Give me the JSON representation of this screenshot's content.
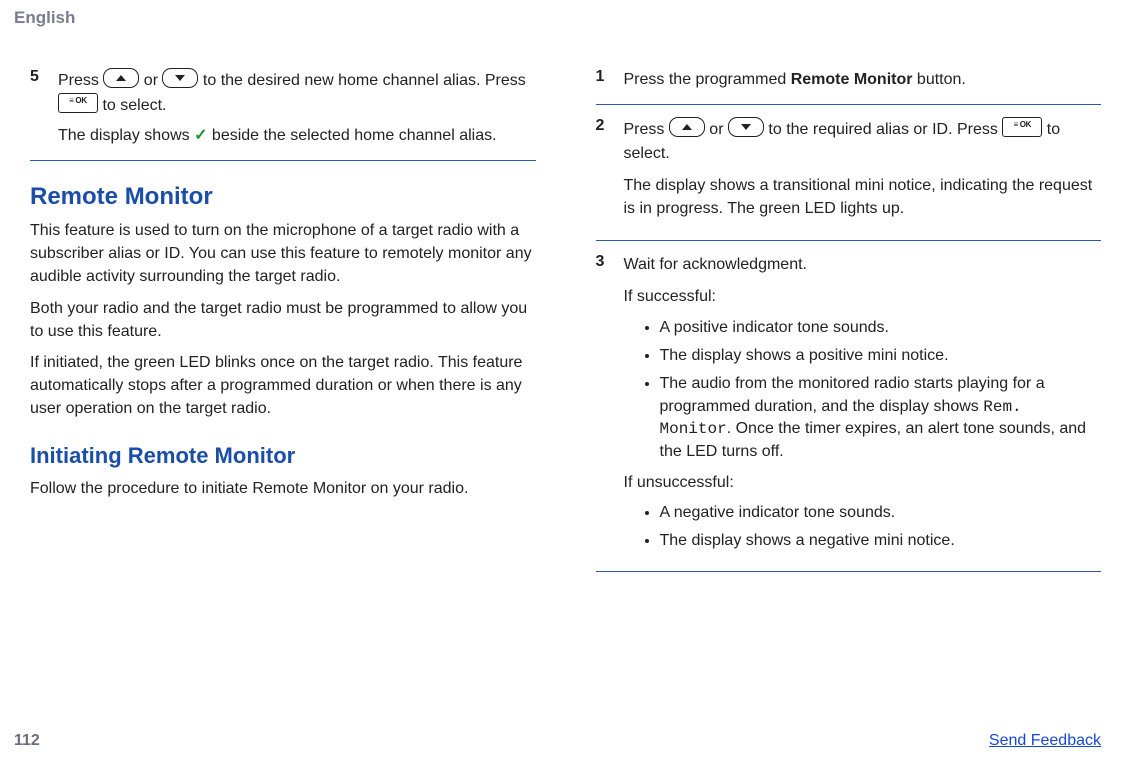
{
  "header": {
    "language": "English"
  },
  "left": {
    "step5": {
      "num": "5",
      "line1a": "Press ",
      "line1b": " or ",
      "line1c": " to the desired new home channel alias. Press ",
      "line1d": " to select.",
      "line2a": "The display shows ",
      "check": "✓",
      "line2b": " beside the selected home channel alias."
    },
    "remote_monitor": {
      "title": "Remote Monitor",
      "p1": "This feature is used to turn on the microphone of a target radio with a subscriber alias or ID. You can use this feature to remotely monitor any audible activity surrounding the target radio.",
      "p2": "Both your radio and the target radio must be programmed to allow you to use this feature.",
      "p3": "If initiated, the green LED blinks once on the target radio. This feature automatically stops after a programmed duration or when there is any user operation on the target radio."
    },
    "initiating": {
      "title": "Initiating Remote Monitor",
      "p1": "Follow the procedure to initiate Remote Monitor on your radio."
    }
  },
  "right": {
    "step1": {
      "num": "1",
      "a": "Press the programmed ",
      "bold": "Remote Monitor",
      "b": " button."
    },
    "step2": {
      "num": "2",
      "l1a": "Press ",
      "l1b": " or ",
      "l1c": " to the required alias or ID. Press ",
      "l1d": " to select.",
      "l2": "The display shows a transitional mini notice, indicating the request is in progress. The green LED lights up."
    },
    "step3": {
      "num": "3",
      "l1": "Wait for acknowledgment.",
      "success_label": "If successful:",
      "success_bullets": [
        "A positive indicator tone sounds.",
        "The display shows a positive mini notice."
      ],
      "success_bullet3_a": "The audio from the monitored radio starts playing for a programmed duration, and the display shows ",
      "success_bullet3_code": "Rem. Monitor",
      "success_bullet3_b": ". Once the timer expires, an alert tone sounds, and the LED turns off.",
      "fail_label": "If unsuccessful:",
      "fail_bullets": [
        "A negative indicator tone sounds.",
        "The display shows a negative mini notice."
      ]
    }
  },
  "footer": {
    "page": "112",
    "feedback": "Send Feedback"
  }
}
